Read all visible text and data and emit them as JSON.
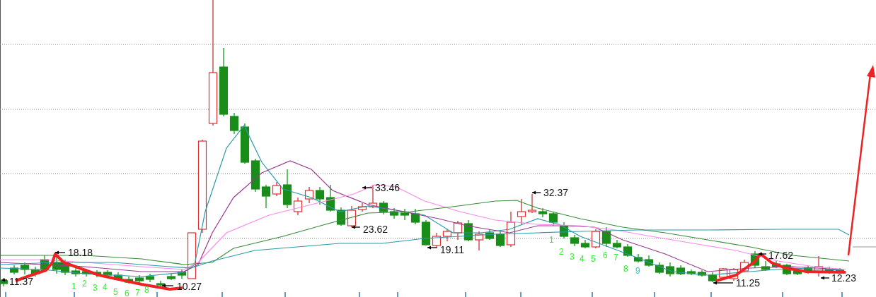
{
  "chart": {
    "price_labels": [
      {
        "text": "18.18"
      },
      {
        "text": "11.37"
      },
      {
        "text": "10.27"
      },
      {
        "text": "33.46"
      },
      {
        "text": "23.62"
      },
      {
        "text": "19.11"
      },
      {
        "text": "32.37"
      },
      {
        "text": "17.62"
      },
      {
        "text": "11.25"
      },
      {
        "text": "12.23"
      }
    ],
    "count_left": [
      {
        "text": "1",
        "color": "#33ee33"
      },
      {
        "text": "2",
        "color": "#33ee33"
      },
      {
        "text": "3",
        "color": "#33ee33"
      },
      {
        "text": "4",
        "color": "#33ee33"
      },
      {
        "text": "5",
        "color": "#33ee33"
      },
      {
        "text": "6",
        "color": "#33ee33"
      },
      {
        "text": "7",
        "color": "#33ee33"
      },
      {
        "text": "8",
        "color": "#33ee33"
      }
    ],
    "count_middle": [
      {
        "text": "1",
        "color": "#33ee33"
      },
      {
        "text": "2",
        "color": "#33ee33"
      },
      {
        "text": "3",
        "color": "#33ee33"
      },
      {
        "text": "4",
        "color": "#33ee33"
      },
      {
        "text": "5",
        "color": "#33ee33"
      },
      {
        "text": "6",
        "color": "#33ee33"
      },
      {
        "text": "7",
        "color": "#33ee33"
      },
      {
        "text": "8",
        "color": "#33ee33"
      },
      {
        "text": "9",
        "color": "#22cccc"
      }
    ]
  }
}
